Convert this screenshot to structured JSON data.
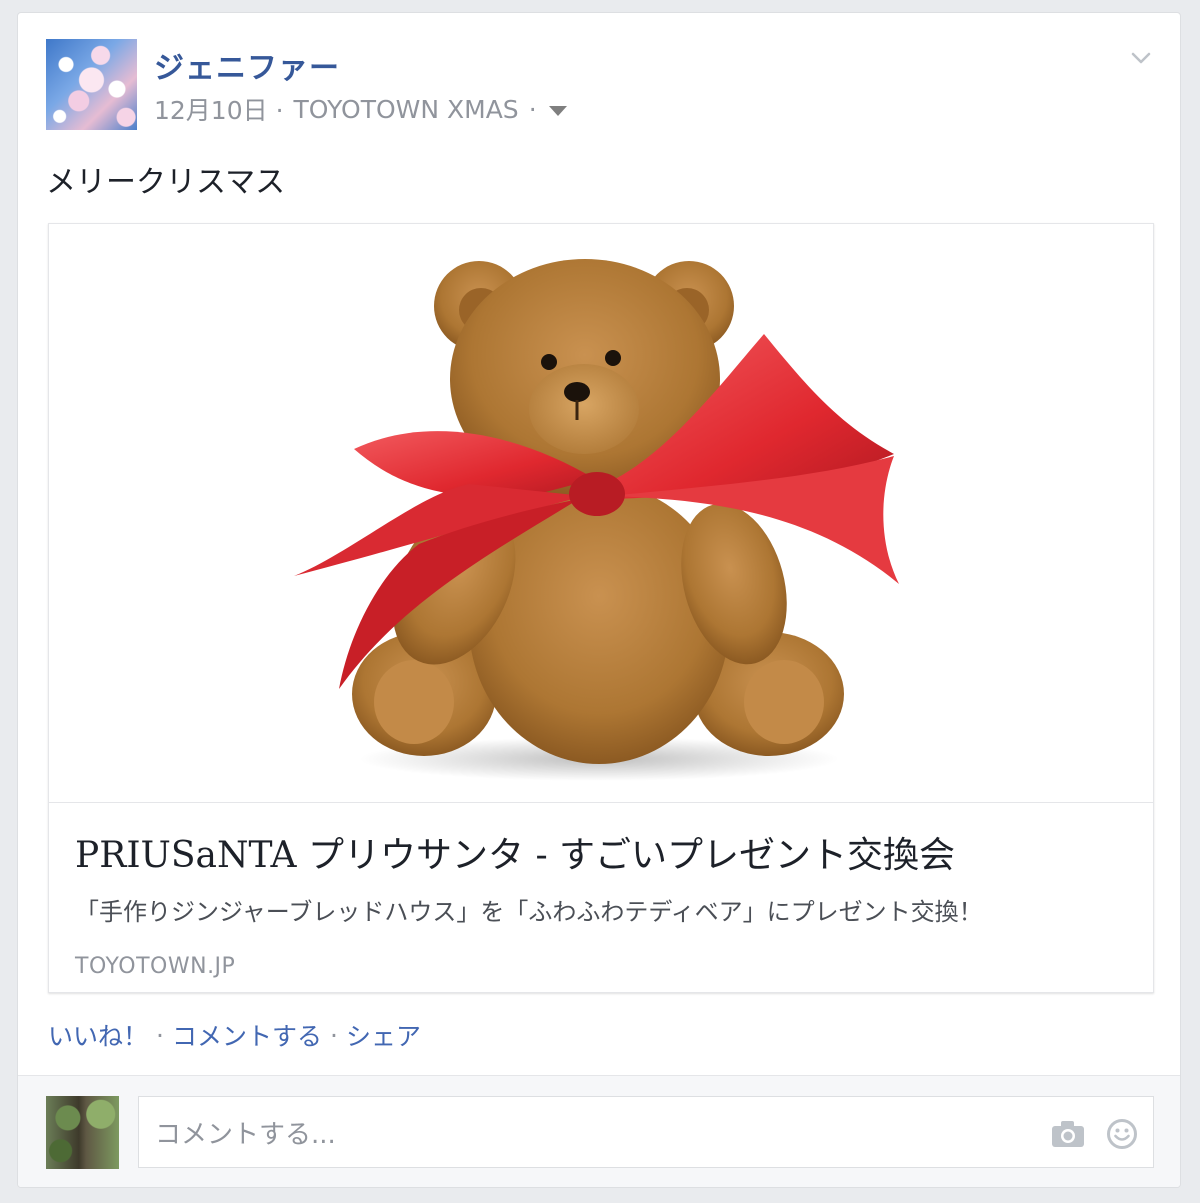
{
  "post": {
    "author": "ジェニファー",
    "date": "12月10日",
    "meta_separator": " · ",
    "group": "TOYOTOWN XMAS",
    "meta_trailing": " ·",
    "text": "メリークリスマス"
  },
  "link_preview": {
    "title": "PRIUSaNTA プリウサンタ - すごいプレゼント交換会",
    "description": "「手作りジンジャーブレッドハウス」を「ふわふわテディベア」にプレゼント交換！",
    "domain": "TOYOTOWN.JP"
  },
  "actions": {
    "like": "いいね！",
    "comment": "コメントする",
    "share": "シェア",
    "separator": "·"
  },
  "comment_box": {
    "placeholder": "コメントする..."
  },
  "icons": {
    "options": "chevron-down-icon",
    "audience": "caret-down-icon",
    "camera": "camera-icon",
    "emoji": "smiley-icon"
  },
  "colors": {
    "author_link": "#365899",
    "action_link": "#4267b2",
    "ribbon": "#e8383d",
    "bear_fur": "#b47c3a"
  }
}
